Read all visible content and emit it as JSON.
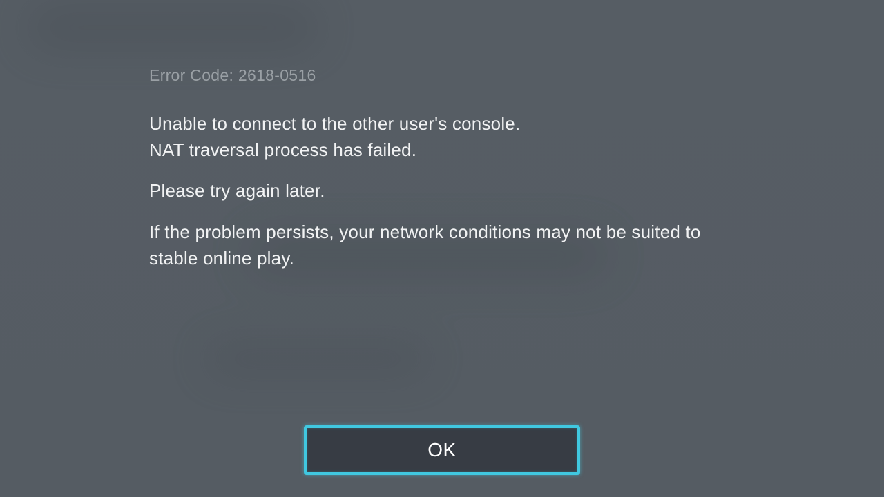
{
  "dialog": {
    "error_label": "Error Code: ",
    "error_code": "2618-0516",
    "line1": "Unable to connect to the other user's console.",
    "line2": "NAT traversal process has failed.",
    "para2": "Please try again later.",
    "para3": "If the problem persists, your network conditions may not be suited to stable online play.",
    "ok_label": "OK"
  }
}
